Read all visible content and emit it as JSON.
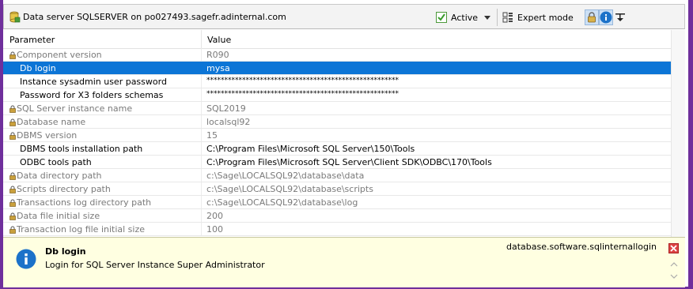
{
  "window": {
    "title": "Data server SQLSERVER on po027493.sagefr.adinternal.com",
    "frame_color": "#6f2f9c"
  },
  "toolbar": {
    "active_label": "Active",
    "active_checked": true,
    "expert_label": "Expert mode",
    "lock_button_pressed": true,
    "info_button_pressed": true
  },
  "grid": {
    "columns": {
      "parameter": "Parameter",
      "value": "Value"
    },
    "selected_row": 1,
    "rows": [
      {
        "label": "Component version",
        "value": "R090",
        "locked": true
      },
      {
        "label": "Db login",
        "value": "mysa",
        "locked": false
      },
      {
        "label": "Instance sysadmin user password",
        "value": "******************************************************",
        "locked": false
      },
      {
        "label": "Password for X3 folders schemas",
        "value": "******************************************************",
        "locked": false
      },
      {
        "label": "SQL Server instance name",
        "value": "SQL2019",
        "locked": true
      },
      {
        "label": "Database name",
        "value": "localsql92",
        "locked": true
      },
      {
        "label": "DBMS version",
        "value": "15",
        "locked": true
      },
      {
        "label": "DBMS tools installation path",
        "value": "C:\\Program Files\\Microsoft SQL Server\\150\\Tools",
        "locked": false
      },
      {
        "label": "ODBC tools path",
        "value": "C:\\Program Files\\Microsoft SQL Server\\Client SDK\\ODBC\\170\\Tools",
        "locked": false
      },
      {
        "label": "Data directory path",
        "value": "c:\\Sage\\LOCALSQL92\\database\\data",
        "locked": true
      },
      {
        "label": "Scripts directory path",
        "value": "c:\\Sage\\LOCALSQL92\\database\\scripts",
        "locked": true
      },
      {
        "label": "Transactions log directory path",
        "value": "c:\\Sage\\LOCALSQL92\\database\\log",
        "locked": true
      },
      {
        "label": "Data file initial size",
        "value": "200",
        "locked": true
      },
      {
        "label": "Transaction log file initial size",
        "value": "100",
        "locked": true
      }
    ]
  },
  "info_panel": {
    "title": "Db login",
    "description": "Login for SQL Server Instance Super Administrator",
    "key": "database.software.sqlinternallogin",
    "background": "#ffffe1"
  },
  "colors": {
    "selection": "#0c75d6",
    "info_icon": "#1c72c9",
    "active_check": "#3a9b2c"
  }
}
